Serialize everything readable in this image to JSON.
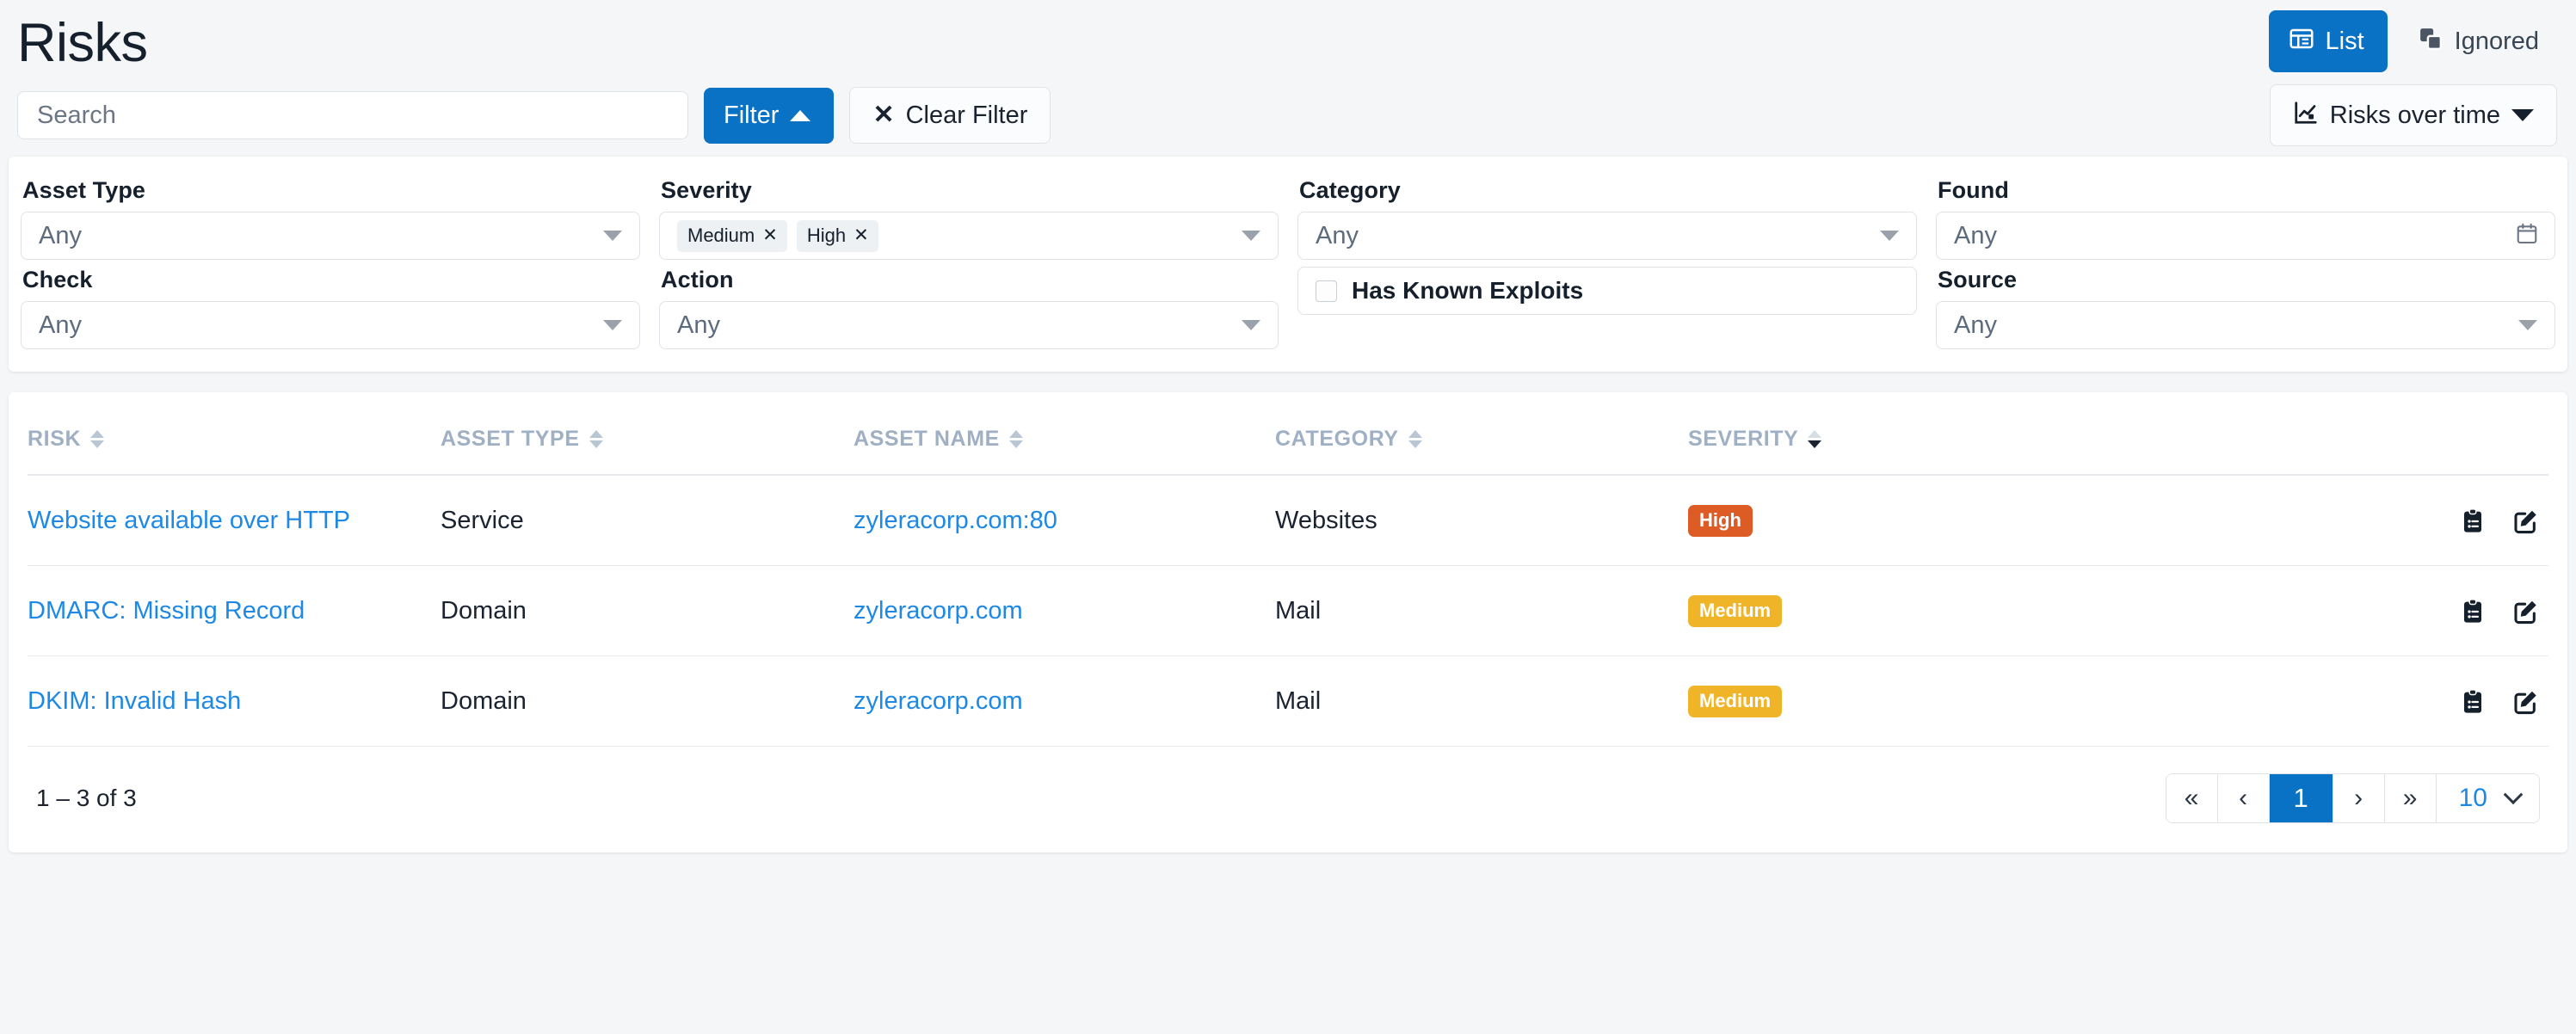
{
  "header": {
    "title": "Risks",
    "list_button": "List",
    "ignored_button": "Ignored"
  },
  "toolbar": {
    "search_placeholder": "Search",
    "filter_button": "Filter",
    "clear_filter_button": "Clear Filter",
    "chart_button": "Risks over time"
  },
  "filters": {
    "asset_type": {
      "label": "Asset Type",
      "value": "Any"
    },
    "severity": {
      "label": "Severity",
      "chips": [
        "Medium",
        "High"
      ]
    },
    "category": {
      "label": "Category",
      "value": "Any"
    },
    "found": {
      "label": "Found",
      "value": "Any"
    },
    "check": {
      "label": "Check",
      "value": "Any"
    },
    "action": {
      "label": "Action",
      "value": "Any"
    },
    "has_known_exploits": {
      "label": "Has Known Exploits",
      "checked": false
    },
    "source": {
      "label": "Source",
      "value": "Any"
    }
  },
  "table": {
    "columns": [
      {
        "label": "Risk",
        "sorted": false
      },
      {
        "label": "Asset Type",
        "sorted": false
      },
      {
        "label": "Asset Name",
        "sorted": false
      },
      {
        "label": "Category",
        "sorted": false
      },
      {
        "label": "Severity",
        "sorted": true
      }
    ],
    "rows": [
      {
        "risk": "Website available over HTTP",
        "asset_type": "Service",
        "asset_name": "zyleracorp.com:80",
        "category": "Websites",
        "severity": "High",
        "severity_level": "high"
      },
      {
        "risk": "DMARC: Missing Record",
        "asset_type": "Domain",
        "asset_name": "zyleracorp.com",
        "category": "Mail",
        "severity": "Medium",
        "severity_level": "medium"
      },
      {
        "risk": "DKIM: Invalid Hash",
        "asset_type": "Domain",
        "asset_name": "zyleracorp.com",
        "category": "Mail",
        "severity": "Medium",
        "severity_level": "medium"
      }
    ]
  },
  "footer": {
    "range": "1 – 3 of 3",
    "first_page": "«",
    "prev_page": "‹",
    "current_page": "1",
    "next_page": "›",
    "last_page": "»",
    "page_size": "10"
  },
  "icons": {
    "list": "table-icon",
    "ignored": "copy-stack-icon",
    "chart": "line-chart-icon",
    "clear": "x-icon",
    "calendar": "calendar-icon",
    "row_details": "clipboard-list-icon",
    "row_edit": "pencil-square-icon"
  },
  "colors": {
    "accent": "#0a72c4",
    "link": "#1e88e5",
    "high": "#dd5b25",
    "medium": "#f0b429",
    "page_bg": "#f4f6f8"
  }
}
